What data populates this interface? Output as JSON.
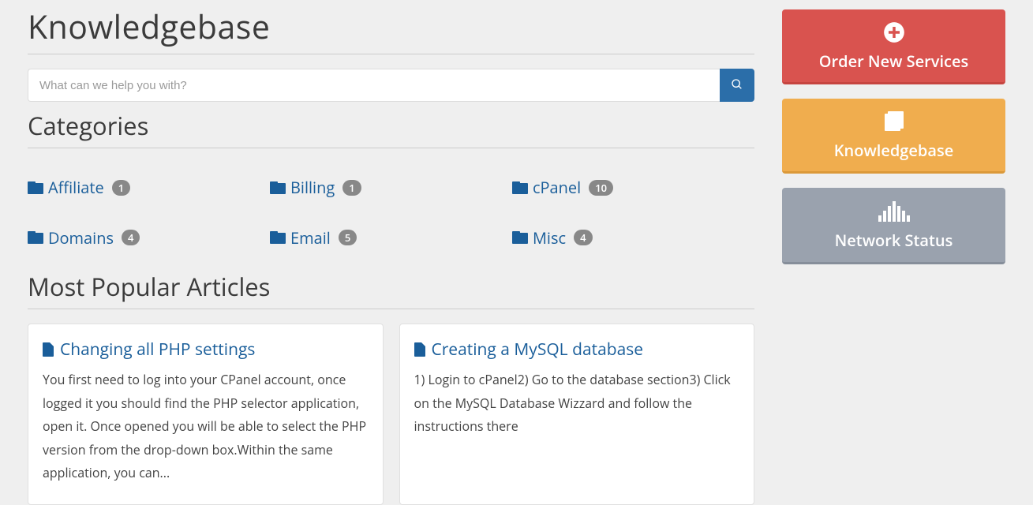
{
  "page": {
    "title": "Knowledgebase",
    "search_placeholder": "What can we help you with?",
    "categories_heading": "Categories",
    "popular_heading": "Most Popular Articles"
  },
  "categories": [
    {
      "label": "Affiliate",
      "count": "1"
    },
    {
      "label": "Billing",
      "count": "1"
    },
    {
      "label": "cPanel",
      "count": "10"
    },
    {
      "label": "Domains",
      "count": "4"
    },
    {
      "label": "Email",
      "count": "5"
    },
    {
      "label": "Misc",
      "count": "4"
    }
  ],
  "articles": [
    {
      "title": "Changing all PHP settings",
      "excerpt": "You first need to log into your CPanel account, once logged it you should find the PHP selector application, open it. Once opened you will be able to select the PHP version from the drop-down box.Within the same application, you can..."
    },
    {
      "title": "Creating a MySQL database",
      "excerpt": "1) Login to cPanel2) Go to the database section3) Click on the MySQL Database Wizzard and follow the instructions there"
    }
  ],
  "sidebar": {
    "order": "Order New Services",
    "kb": "Knowledgebase",
    "status": "Network Status"
  }
}
